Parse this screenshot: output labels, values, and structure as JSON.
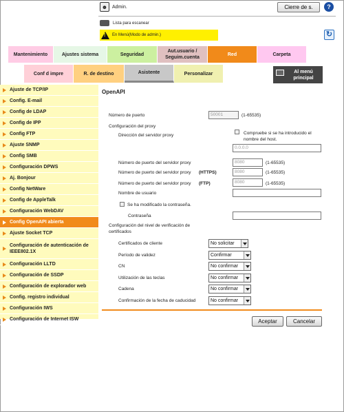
{
  "header": {
    "user_label": "Admin.",
    "logout_label": "Cierre de s.",
    "help_icon": "?",
    "scan_list_label": "Lista para escanear",
    "mode_label": "En Menú(Modo de admin.)"
  },
  "tabs_row1": [
    {
      "label": "Mantenimiento",
      "color": "#ffcce5"
    },
    {
      "label": "Ajustes sistema",
      "color": "#e6f7e6"
    },
    {
      "label": "Seguridad",
      "color": "#ccf0a0"
    },
    {
      "label": "Aut.usuario / Seguim.cuenta",
      "color": "#e0c0c0"
    },
    {
      "label": "Red",
      "color": "#f18a1a"
    },
    {
      "label": "Carpeta",
      "color": "#ffc8f0"
    }
  ],
  "tabs_row2": [
    {
      "label": "Conf d impre",
      "color": "#ffd0d8"
    },
    {
      "label": "R. de destino",
      "color": "#ffd080"
    },
    {
      "label": "Asistente",
      "color": "#c8c8c8"
    },
    {
      "label": "Personalizar",
      "color": "#f0f0b0"
    }
  ],
  "menu_button": {
    "label": "Al menú principal",
    "color": "#444444"
  },
  "sidebar": {
    "items": [
      {
        "label": "Ajuste de TCP/IP",
        "active": false
      },
      {
        "label": "Config. E-mail",
        "active": false
      },
      {
        "label": "Config de LDAP",
        "active": false
      },
      {
        "label": "Config de IPP",
        "active": false
      },
      {
        "label": "Config FTP",
        "active": false
      },
      {
        "label": "Ajuste SNMP",
        "active": false
      },
      {
        "label": "Config SMB",
        "active": false
      },
      {
        "label": "Configuración DPWS",
        "active": false
      },
      {
        "label": "Aj. Bonjour",
        "active": false
      },
      {
        "label": "Config NetWare",
        "active": false
      },
      {
        "label": "Config de AppleTalk",
        "active": false
      },
      {
        "label": "Configuración WebDAV",
        "active": false
      },
      {
        "label": "Config OpenAPI abierta",
        "active": true
      },
      {
        "label": "Ajuste Socket TCP",
        "active": false
      },
      {
        "label": "Configuración de autenticación de IEEE802.1X",
        "active": false
      },
      {
        "label": "Configuración LLTD",
        "active": false
      },
      {
        "label": "Configuración de SSDP",
        "active": false
      },
      {
        "label": "Configuración de explorador web",
        "active": false
      },
      {
        "label": "Config. registro individual",
        "active": false
      },
      {
        "label": "Configuración IWS",
        "active": false
      },
      {
        "label": "Configuración de Internet ISW",
        "active": false
      }
    ]
  },
  "form": {
    "title": "OpenAPI",
    "port_label": "Número de puerto",
    "port_value": "50001",
    "port_range": "(1-65535)",
    "proxy_section": "Configuración del proxy",
    "proxy_address_label": "Dirección del servidor proxy",
    "proxy_check_label": "Compruebe si se ha introducido el nombre del host.",
    "proxy_address_value": "0.0.0.0",
    "proxy_port_label": "Número de puerto del servidor proxy",
    "proxy_port_value": "8080",
    "proxy_port_https_label": "Número de puerto del servidor proxy",
    "https_tag": "(HTTPS)",
    "proxy_port_https_value": "8080",
    "proxy_port_ftp_label": "Número de puerto del servidor proxy",
    "ftp_tag": "(FTP)",
    "proxy_port_ftp_value": "8080",
    "range": "(1-65535)",
    "username_label": "Nombre de usuario",
    "password_changed_label": "Se ha modificado la contraseña.",
    "password_label": "Contraseña",
    "verify_section": "Configuración del nivel de verificación de certificados",
    "cert_rows": [
      {
        "label": "Certificados de cliente",
        "value": "No solicitar"
      },
      {
        "label": "Período de validez",
        "value": "Confirmar"
      },
      {
        "label": "CN",
        "value": "No confirmar"
      },
      {
        "label": "Utilización de las teclas",
        "value": "No confirmar"
      },
      {
        "label": "Cadena",
        "value": "No confirmar"
      },
      {
        "label": "Confirmación de la fecha de caducidad",
        "value": "No confirmar"
      }
    ],
    "accept_label": "Aceptar",
    "cancel_label": "Cancelar"
  }
}
